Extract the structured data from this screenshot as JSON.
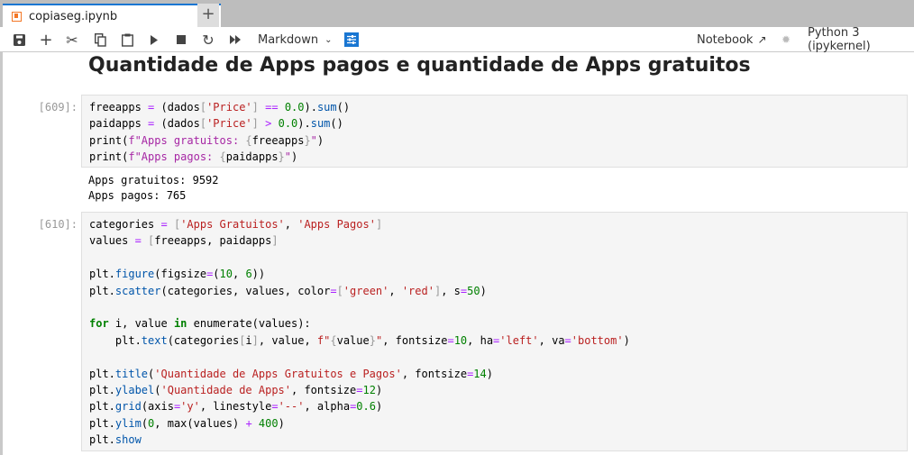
{
  "tab": {
    "title": "copiaseg.ipynb",
    "close_icon": "×",
    "add_icon": "+"
  },
  "toolbar": {
    "cell_type": "Markdown",
    "notebook_label": "Notebook",
    "kernel": "Python 3 (ipykernel)"
  },
  "heading": "Quantidade de Apps pagos e quantidade de Apps gratuitos",
  "colors": {
    "accent": "#1976d2",
    "tab_icon": "#f37726"
  },
  "cells": [
    {
      "prompt": "[609]:",
      "lines": [
        [
          [
            "freeapps ",
            ""
          ],
          [
            "=",
            "op"
          ],
          [
            " (dados",
            ""
          ],
          [
            "[",
            "br"
          ],
          [
            "'Price'",
            "str"
          ],
          [
            "]",
            "br"
          ],
          [
            " ",
            ""
          ],
          [
            "==",
            "op"
          ],
          [
            " ",
            ""
          ],
          [
            "0.0",
            "num"
          ],
          [
            ").",
            ""
          ],
          [
            "sum",
            "fn"
          ],
          [
            "()",
            ""
          ]
        ],
        [
          [
            "paidapps ",
            ""
          ],
          [
            "=",
            "op"
          ],
          [
            " (dados",
            ""
          ],
          [
            "[",
            "br"
          ],
          [
            "'Price'",
            "str"
          ],
          [
            "]",
            "br"
          ],
          [
            " ",
            ""
          ],
          [
            ">",
            "op"
          ],
          [
            " ",
            ""
          ],
          [
            "0.0",
            "num"
          ],
          [
            ").",
            ""
          ],
          [
            "sum",
            "fn"
          ],
          [
            "()",
            ""
          ]
        ],
        [
          [
            "print(",
            ""
          ],
          [
            "f\"Apps gratuitos: ",
            "fs"
          ],
          [
            "{",
            "br"
          ],
          [
            "freeapps",
            ""
          ],
          [
            "}",
            "br"
          ],
          [
            "\"",
            "fs"
          ],
          [
            ")",
            ""
          ]
        ],
        [
          [
            "print(",
            ""
          ],
          [
            "f\"Apps pagos: ",
            "fs"
          ],
          [
            "{",
            "br"
          ],
          [
            "paidapps",
            ""
          ],
          [
            "}",
            "br"
          ],
          [
            "\"",
            "fs"
          ],
          [
            ")",
            ""
          ]
        ]
      ],
      "output": [
        "Apps gratuitos: 9592",
        "Apps pagos: 765"
      ]
    },
    {
      "prompt": "[610]:",
      "lines": [
        [
          [
            "categories ",
            ""
          ],
          [
            "=",
            "op"
          ],
          [
            " ",
            ""
          ],
          [
            "[",
            "br"
          ],
          [
            "'Apps Gratuitos'",
            "str"
          ],
          [
            ", ",
            ""
          ],
          [
            "'Apps Pagos'",
            "str"
          ],
          [
            "]",
            "br"
          ]
        ],
        [
          [
            "values ",
            ""
          ],
          [
            "=",
            "op"
          ],
          [
            " ",
            ""
          ],
          [
            "[",
            "br"
          ],
          [
            "freeapps, paidapps",
            ""
          ],
          [
            "]",
            "br"
          ]
        ],
        [],
        [
          [
            "plt.",
            ""
          ],
          [
            "figure",
            "fn"
          ],
          [
            "(figsize",
            ""
          ],
          [
            "=",
            "op"
          ],
          [
            "(",
            ""
          ],
          [
            "10",
            "num"
          ],
          [
            ", ",
            ""
          ],
          [
            "6",
            "num"
          ],
          [
            "))",
            ""
          ]
        ],
        [
          [
            "plt.",
            ""
          ],
          [
            "scatter",
            "fn"
          ],
          [
            "(categories, values, color",
            ""
          ],
          [
            "=",
            "op"
          ],
          [
            "[",
            "br"
          ],
          [
            "'green'",
            "str"
          ],
          [
            ", ",
            ""
          ],
          [
            "'red'",
            "str"
          ],
          [
            "]",
            "br"
          ],
          [
            ", s",
            ""
          ],
          [
            "=",
            "op"
          ],
          [
            "50",
            "num"
          ],
          [
            ")",
            ""
          ]
        ],
        [],
        [
          [
            "for",
            "kw"
          ],
          [
            " i, value ",
            ""
          ],
          [
            "in",
            "kw"
          ],
          [
            " enumerate(values):",
            ""
          ]
        ],
        [
          [
            "    plt.",
            ""
          ],
          [
            "text",
            "fn"
          ],
          [
            "(categories",
            ""
          ],
          [
            "[",
            "br"
          ],
          [
            "i",
            ""
          ],
          [
            "]",
            "br"
          ],
          [
            ", value, ",
            ""
          ],
          [
            "f\"",
            "str"
          ],
          [
            "{",
            "br"
          ],
          [
            "value",
            ""
          ],
          [
            "}",
            "br"
          ],
          [
            "\"",
            "str"
          ],
          [
            ", fontsize",
            ""
          ],
          [
            "=",
            "op"
          ],
          [
            "10",
            "num"
          ],
          [
            ", ha",
            ""
          ],
          [
            "=",
            "op"
          ],
          [
            "'left'",
            "str"
          ],
          [
            ", va",
            ""
          ],
          [
            "=",
            "op"
          ],
          [
            "'bottom'",
            "str"
          ],
          [
            ")",
            ""
          ]
        ],
        [],
        [
          [
            "plt.",
            ""
          ],
          [
            "title",
            "fn"
          ],
          [
            "(",
            ""
          ],
          [
            "'Quantidade de Apps Gratuitos e Pagos'",
            "str"
          ],
          [
            ", fontsize",
            ""
          ],
          [
            "=",
            "op"
          ],
          [
            "14",
            "num"
          ],
          [
            ")",
            ""
          ]
        ],
        [
          [
            "plt.",
            ""
          ],
          [
            "ylabel",
            "fn"
          ],
          [
            "(",
            ""
          ],
          [
            "'Quantidade de Apps'",
            "str"
          ],
          [
            ", fontsize",
            ""
          ],
          [
            "=",
            "op"
          ],
          [
            "12",
            "num"
          ],
          [
            ")",
            ""
          ]
        ],
        [
          [
            "plt.",
            ""
          ],
          [
            "grid",
            "fn"
          ],
          [
            "(axis",
            ""
          ],
          [
            "=",
            "op"
          ],
          [
            "'y'",
            "str"
          ],
          [
            ", linestyle",
            ""
          ],
          [
            "=",
            "op"
          ],
          [
            "'--'",
            "str"
          ],
          [
            ", alpha",
            ""
          ],
          [
            "=",
            "op"
          ],
          [
            "0.6",
            "num"
          ],
          [
            ")",
            ""
          ]
        ],
        [
          [
            "plt.",
            ""
          ],
          [
            "ylim",
            "fn"
          ],
          [
            "(",
            ""
          ],
          [
            "0",
            "num"
          ],
          [
            ", max(values) ",
            ""
          ],
          [
            "+",
            "op"
          ],
          [
            " ",
            ""
          ],
          [
            "400",
            "num"
          ],
          [
            ")",
            ""
          ]
        ],
        [
          [
            "plt.",
            ""
          ],
          [
            "show",
            "fn"
          ]
        ]
      ]
    }
  ]
}
